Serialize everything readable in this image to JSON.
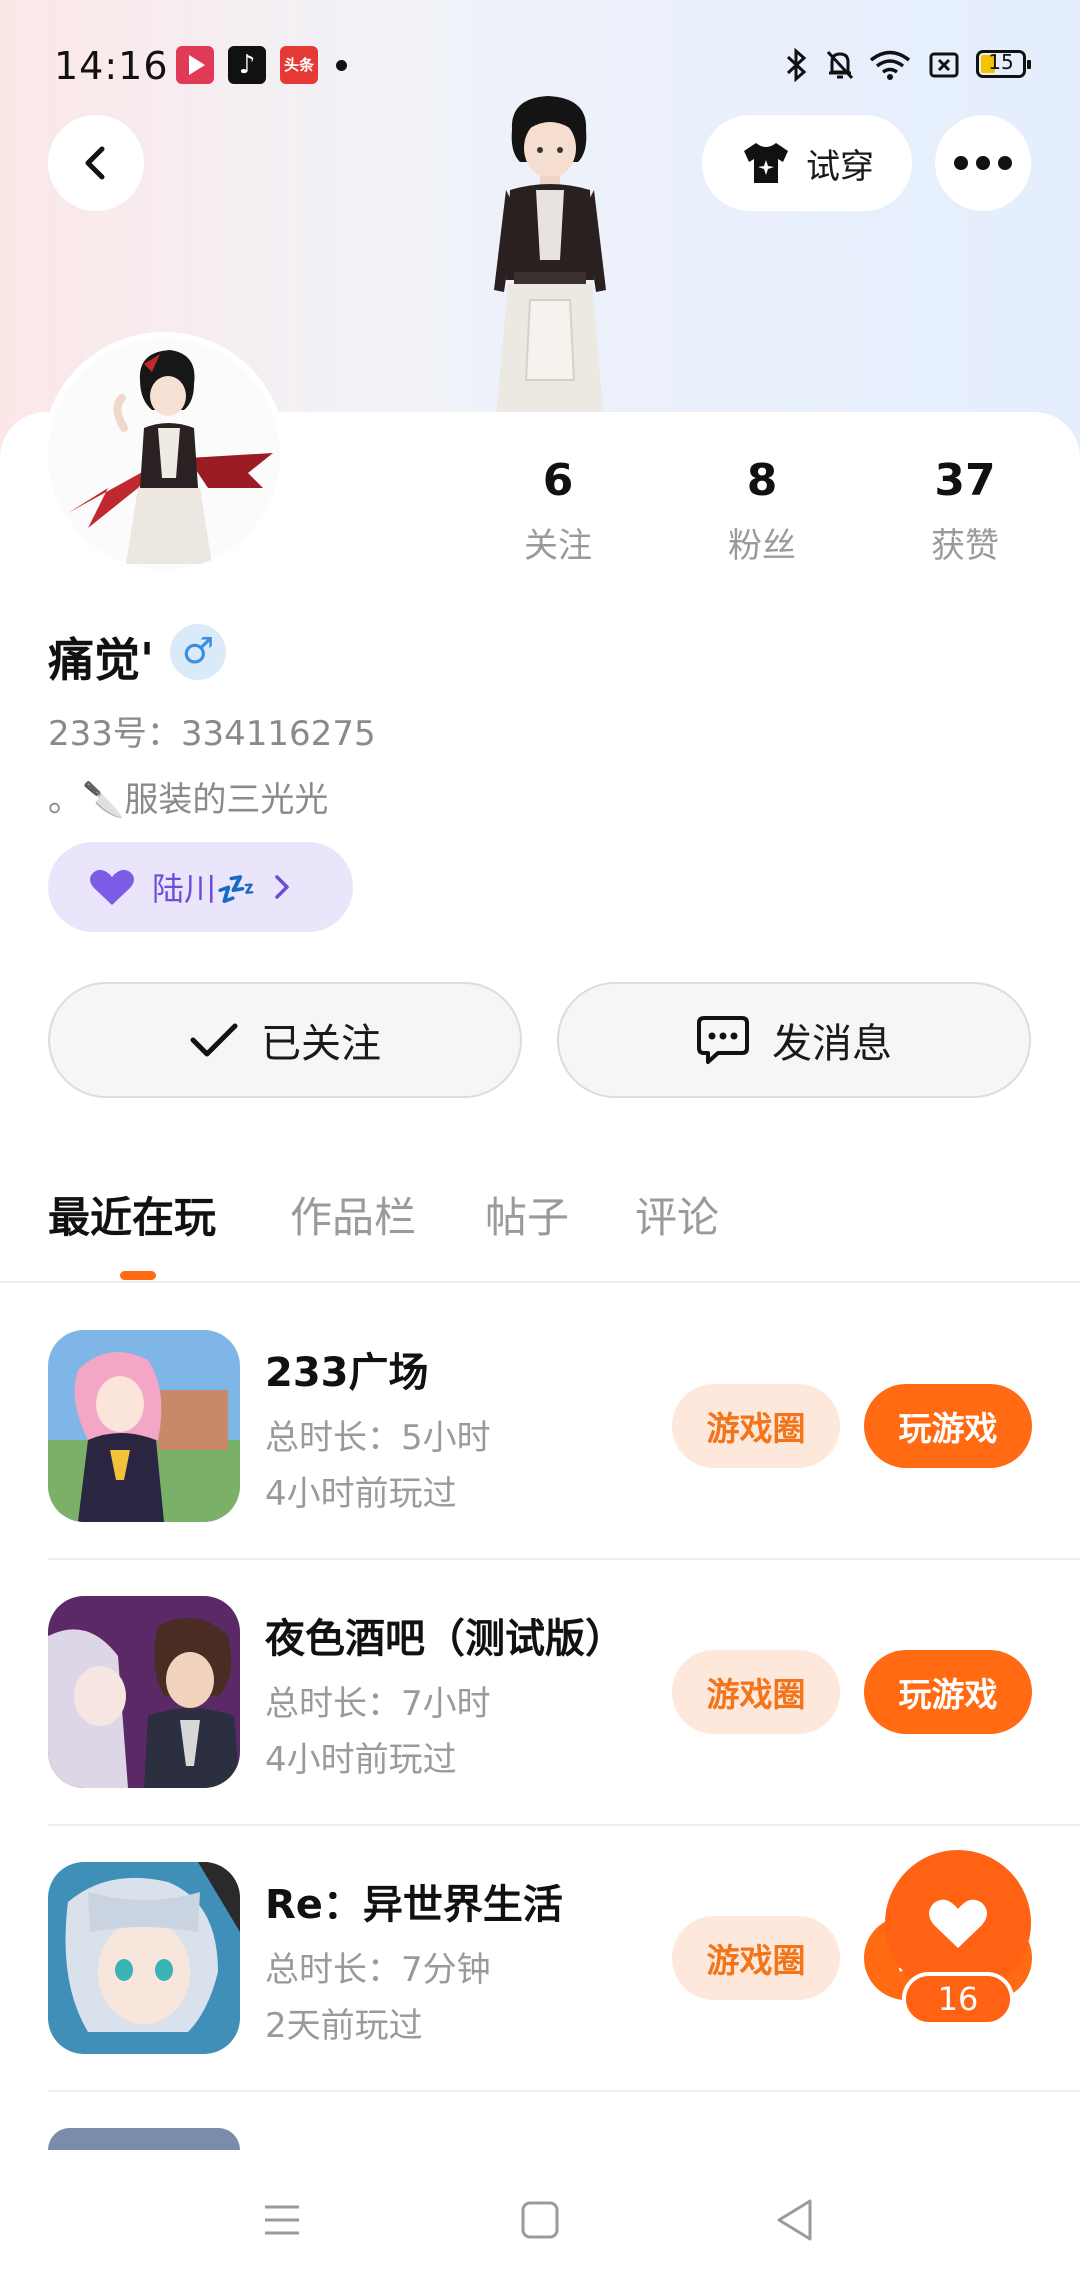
{
  "status_bar": {
    "time": "14:16",
    "apps": [
      "video-play-icon",
      "tiktok-icon",
      "toutiao-icon"
    ],
    "toutiao_text": "头条",
    "battery": "15"
  },
  "top_bar": {
    "try_on_label": "试穿"
  },
  "stats": [
    {
      "value": "6",
      "label": "关注"
    },
    {
      "value": "8",
      "label": "粉丝"
    },
    {
      "value": "37",
      "label": "获赞"
    }
  ],
  "profile": {
    "name": "痛觉'",
    "gender_symbol": "♂",
    "id_text": "233号：334116275",
    "bio": "。🔪服装的三光光",
    "partner_name": "陆川💤"
  },
  "actions": {
    "followed": "已关注",
    "message": "发消息"
  },
  "tabs": [
    "最近在玩",
    "作品栏",
    "帖子",
    "评论"
  ],
  "games": [
    {
      "title": "233广场",
      "duration": "总时长：5小时",
      "last_played": "4小时前玩过",
      "circle_label": "游戏圈",
      "play_label": "玩游戏"
    },
    {
      "title": "夜色酒吧（测试版）",
      "duration": "总时长：7小时",
      "last_played": "4小时前玩过",
      "circle_label": "游戏圈",
      "play_label": "玩游戏"
    },
    {
      "title": "Re：异世界生活",
      "duration": "总时长：7分钟",
      "last_played": "2天前玩过",
      "circle_label": "游戏圈",
      "play_label": "玩游戏"
    }
  ],
  "like": {
    "count": "16"
  },
  "colors": {
    "accent": "#ff6a12",
    "partner_chip": "#ebe5fc",
    "gender_blue": "#3a8ee6"
  }
}
